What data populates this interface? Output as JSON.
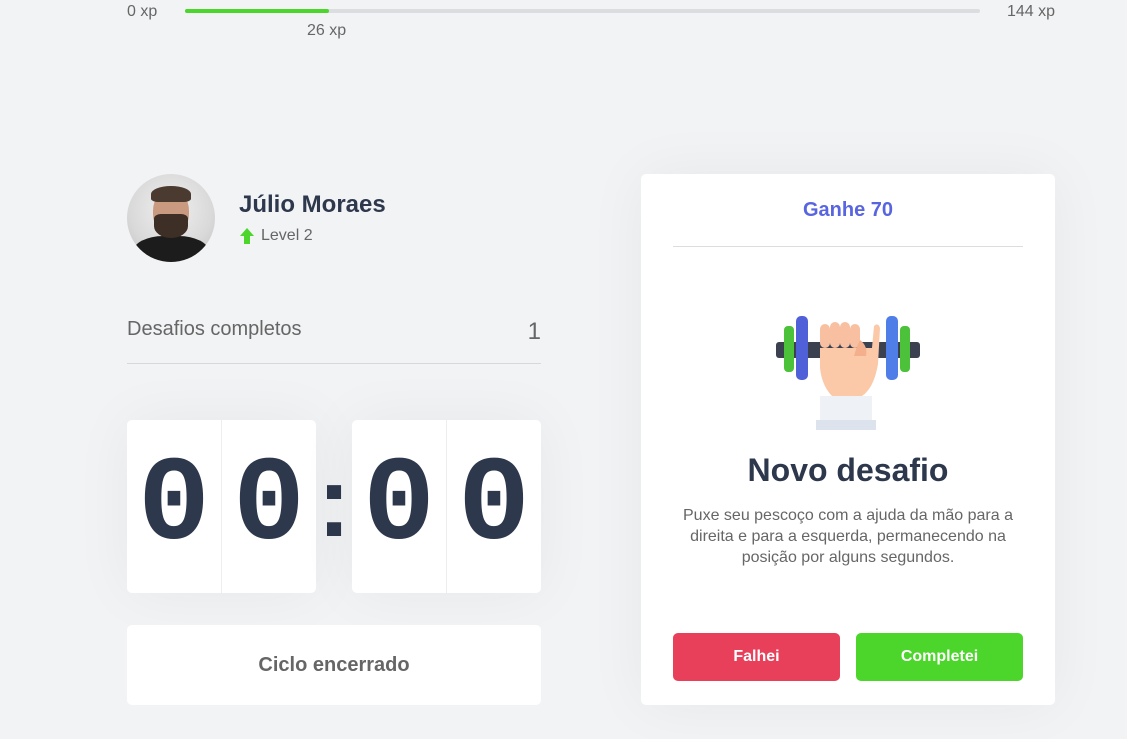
{
  "experience": {
    "min_label": "0 xp",
    "max_label": "144 xp",
    "current_label": "26 xp",
    "current": 26,
    "max": 144,
    "bar_color": "#4cd62b"
  },
  "profile": {
    "name": "Júlio Moraes",
    "level_label": "Level 2",
    "level_icon": "level-up-arrow-icon"
  },
  "completed": {
    "label": "Desafios completos",
    "count": "1"
  },
  "countdown": {
    "minute_left": "0",
    "minute_right": "0",
    "separator": ":",
    "second_left": "0",
    "second_right": "0"
  },
  "cycle_button": {
    "label": "Ciclo encerrado"
  },
  "challenge": {
    "header": "Ganhe 70",
    "icon": "dumbbell-body-icon",
    "title": "Novo desafio",
    "description": "Puxe seu pescoço com a ajuda da mão para a direita e para a esquerda, permanecendo na posição por alguns segundos.",
    "fail_label": "Falhei",
    "success_label": "Completei"
  },
  "colors": {
    "accent": "#5965e0",
    "title": "#2e384d",
    "red": "#e83f5b",
    "green": "#4cd62b"
  }
}
